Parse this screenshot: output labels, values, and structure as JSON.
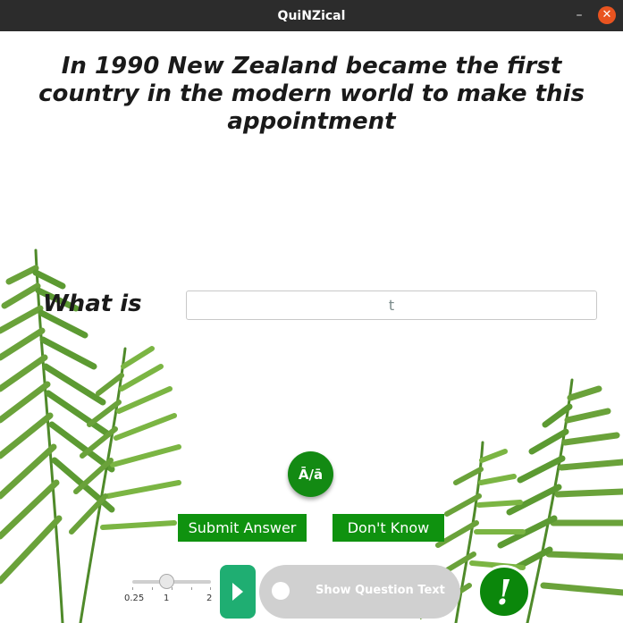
{
  "window": {
    "title": "QuiNZical"
  },
  "question": {
    "text": "In 1990 New Zealand became the first country in the modern world to make this appointment"
  },
  "answer": {
    "prompt": "What is",
    "value": "t"
  },
  "macron_button": {
    "label": "Ā/ā"
  },
  "buttons": {
    "submit": "Submit Answer",
    "dont_know": "Don't Know"
  },
  "speed": {
    "ticks": [
      "0.25",
      "1",
      "2"
    ],
    "value": 1
  },
  "toggle": {
    "label": "Show Question Text",
    "on": false
  },
  "alert_button": {
    "label": "!"
  },
  "colors": {
    "accent_green": "#0f920f",
    "play_green": "#1fae72",
    "close_orange": "#e95420"
  }
}
